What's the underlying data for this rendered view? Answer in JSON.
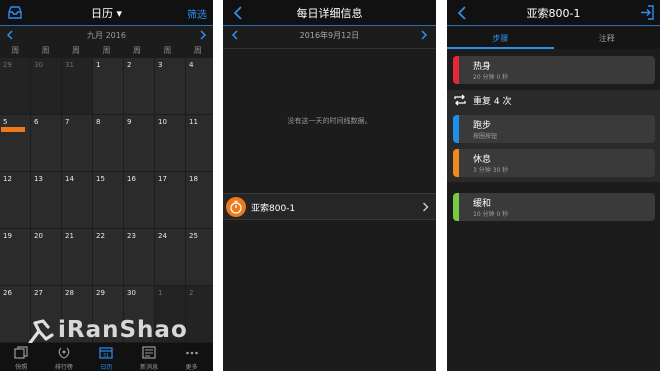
{
  "screen1": {
    "title": "日历 ▾",
    "filter_label": "筛选",
    "month_label": "九月 2016",
    "weekdays": [
      "周",
      "周",
      "周",
      "周",
      "周",
      "周",
      "周"
    ],
    "weeks": [
      [
        "29",
        "30",
        "31",
        "1",
        "2",
        "3",
        "4"
      ],
      [
        "5",
        "6",
        "7",
        "8",
        "9",
        "10",
        "11"
      ],
      [
        "12",
        "13",
        "14",
        "15",
        "16",
        "17",
        "18"
      ],
      [
        "19",
        "20",
        "21",
        "22",
        "23",
        "24",
        "25"
      ],
      [
        "26",
        "27",
        "28",
        "29",
        "30",
        "1",
        "2"
      ]
    ],
    "marked_day": "12",
    "tabs": [
      {
        "label": "快照",
        "icon": "snapshot-icon"
      },
      {
        "label": "排行榜",
        "icon": "laurel-icon"
      },
      {
        "label": "日历",
        "icon": "calendar-icon",
        "active": true
      },
      {
        "label": "新消息",
        "icon": "news-icon"
      },
      {
        "label": "更多",
        "icon": "more-dots-icon"
      }
    ],
    "watermark": "iRanShao",
    "colors": {
      "accent": "#2f8ef0",
      "activity": "#ee7a1c",
      "cell": "#2b2b2b",
      "cell_dim": "#232323"
    }
  },
  "screen2": {
    "title": "每日详细信息",
    "date_label": "2016年9月12日",
    "empty_message": "没有这一天的时间线数据。",
    "activity_name": "亚索800-1",
    "activity_icon": "stopwatch-icon"
  },
  "screen3": {
    "title": "亚索800-1",
    "tabs": [
      "步骤",
      "注释"
    ],
    "selected_tab": "步骤",
    "steps": [
      {
        "name": "热身",
        "detail": "20 分钟 0 秒",
        "color": "#e8283a"
      },
      {
        "name": "跑步",
        "detail": "按圈按钮",
        "color": "#1e90e8"
      },
      {
        "name": "休息",
        "detail": "3 分钟 30 秒",
        "color": "#f08a1c"
      },
      {
        "name": "缓和",
        "detail": "10 分钟 0 秒",
        "color": "#7ac943"
      }
    ],
    "repeat_label": "重复 4 次"
  }
}
